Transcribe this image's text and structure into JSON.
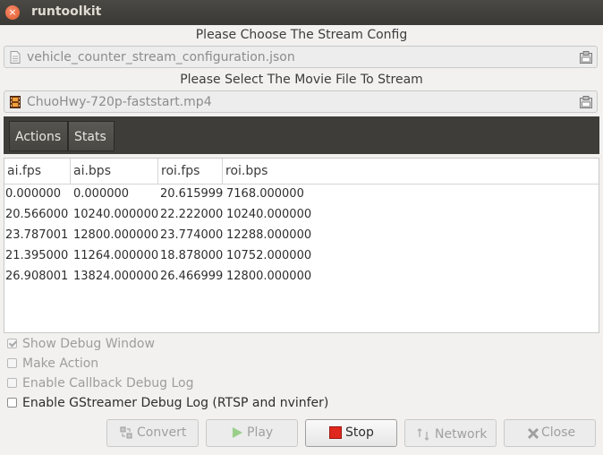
{
  "window": {
    "title": "runtoolkit",
    "close_icon_glyph": "×"
  },
  "stream_config": {
    "label": "Please Choose The Stream Config",
    "value": "vehicle_counter_stream_configuration.json",
    "icon": "document-icon"
  },
  "movie_file": {
    "label": "Please Select The Movie File To Stream",
    "value": "ChuoHwy-720p-faststart.mp4",
    "icon": "film-icon"
  },
  "tabs": [
    {
      "label": "Actions",
      "active": true
    },
    {
      "label": "Stats",
      "active": false
    }
  ],
  "table": {
    "columns": [
      "ai.fps",
      "ai.bps",
      "roi.fps",
      "roi.bps"
    ],
    "rows": [
      [
        "0.000000",
        "0.000000",
        "20.615999",
        "7168.000000"
      ],
      [
        "20.566000",
        "10240.000000",
        "22.222000",
        "10240.000000"
      ],
      [
        "23.787001",
        "12800.000000",
        "23.774000",
        "12288.000000"
      ],
      [
        "21.395000",
        "11264.000000",
        "18.878000",
        "10752.000000"
      ],
      [
        "26.908001",
        "13824.000000",
        "26.466999",
        "12800.000000"
      ]
    ]
  },
  "options": [
    {
      "label": "Show Debug Window",
      "checked": true,
      "enabled": false
    },
    {
      "label": "Make Action",
      "checked": false,
      "enabled": false
    },
    {
      "label": "Enable Callback Debug Log",
      "checked": false,
      "enabled": false
    },
    {
      "label": "Enable GStreamer Debug Log (RTSP and nvinfer)",
      "checked": false,
      "enabled": true
    }
  ],
  "buttons": {
    "convert": {
      "label": "Convert",
      "enabled": false
    },
    "play": {
      "label": "Play",
      "enabled": false
    },
    "stop": {
      "label": "Stop",
      "enabled": true
    },
    "network": {
      "label": "Network",
      "enabled": false
    },
    "close": {
      "label": "Close",
      "enabled": false
    }
  },
  "colors": {
    "titlebar": "#3a3935",
    "tabbar": "#3e3d39",
    "stop_icon": "#e0281e",
    "play_icon": "#7fc56a"
  }
}
